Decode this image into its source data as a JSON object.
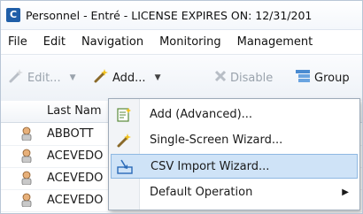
{
  "window": {
    "title": "Personnel - Entré - LICENSE EXPIRES ON: 12/31/201",
    "app_icon_glyph": "C"
  },
  "menubar": {
    "items": [
      "File",
      "Edit",
      "Navigation",
      "Monitoring",
      "Management"
    ]
  },
  "toolbar": {
    "edit_label": "Edit...",
    "add_label": "Add...",
    "disable_label": "Disable",
    "group_label": "Group"
  },
  "grid": {
    "column_header": "Last Nam",
    "rows": [
      "ABBOTT",
      "ACEVEDO",
      "ACEVEDO",
      "ACEVEDO"
    ]
  },
  "dropdown": {
    "items": [
      {
        "label": "Add (Advanced)...",
        "icon": "form-icon"
      },
      {
        "label": "Single-Screen Wizard...",
        "icon": "wand-icon"
      },
      {
        "label": "CSV Import Wizard...",
        "icon": "csv-import-icon",
        "highlighted": true
      },
      {
        "label": "Default Operation",
        "icon": "",
        "submenu": true
      }
    ]
  },
  "colors": {
    "highlight": "#cfe3f7",
    "highlight_border": "#8eb8e2",
    "app_icon": "#1f5ea8"
  }
}
